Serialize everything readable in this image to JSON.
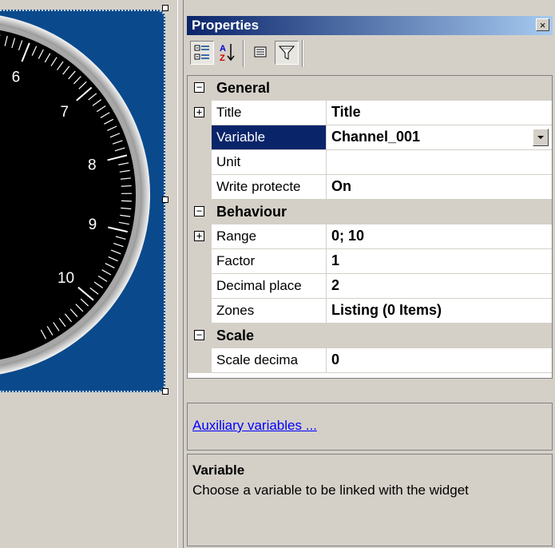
{
  "gauge": {
    "scale_labels": [
      "6",
      "7",
      "8",
      "9",
      "10"
    ]
  },
  "properties": {
    "title": "Properties",
    "close_label": "×",
    "toolbar": {
      "categorized_icon": "categorized-icon",
      "alphabetical_icon": "sort-az-icon",
      "property_pages_icon": "property-pages-icon",
      "filter_icon": "filter-icon"
    },
    "categories": [
      {
        "label": "General",
        "expander": "−",
        "rows": [
          {
            "name": "Title",
            "value": "Title",
            "expander": "+"
          },
          {
            "name": "Variable",
            "value": "Channel_001",
            "selected": true
          },
          {
            "name": "Unit",
            "value": ""
          },
          {
            "name": "Write protecte",
            "value": "On"
          }
        ]
      },
      {
        "label": "Behaviour",
        "expander": "−",
        "rows": [
          {
            "name": "Range",
            "value": "0; 10",
            "expander": "+"
          },
          {
            "name": "Factor",
            "value": "1"
          },
          {
            "name": "Decimal place",
            "value": "2"
          },
          {
            "name": "Zones",
            "value": "Listing (0 Items)"
          }
        ]
      },
      {
        "label": "Scale",
        "expander": "−",
        "rows": [
          {
            "name": "Scale decima",
            "value": "0"
          }
        ]
      }
    ],
    "aux_link": "Auxiliary variables ...",
    "help": {
      "title": "Variable",
      "text": "Choose a variable to be linked with the widget"
    }
  },
  "colors": {
    "gauge_background": "#0a4a8c",
    "titlebar_start": "#0a246a",
    "selection": "#0a246a"
  }
}
